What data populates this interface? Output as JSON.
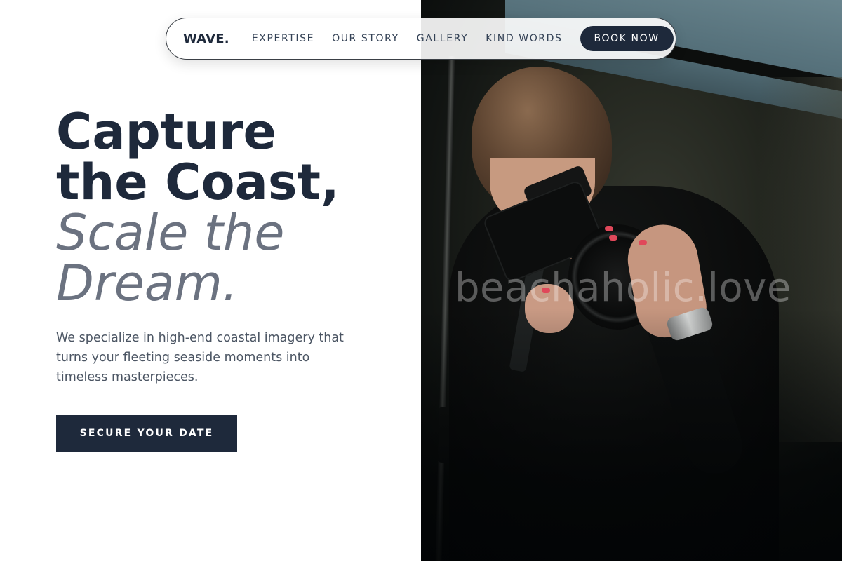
{
  "nav": {
    "logo": "WAVE.",
    "links": [
      "EXPERTISE",
      "OUR STORY",
      "GALLERY",
      "KIND WORDS"
    ],
    "cta_label": "BOOK NOW"
  },
  "hero": {
    "headline_line1": "Capture",
    "headline_line2": "the Coast,",
    "headline_italic_line1": "Scale the",
    "headline_italic_line2": "Dream.",
    "description": "We specialize in high-end coastal imagery that turns your fleeting seaside moments into timeless masterpieces.",
    "cta_label": "SECURE YOUR DATE"
  },
  "photo": {
    "watermark": "beachaholic.love"
  },
  "colors": {
    "primary": "#1e293b",
    "muted_heading": "#6b7280",
    "body_text": "#4b5563",
    "background": "#ffffff"
  }
}
